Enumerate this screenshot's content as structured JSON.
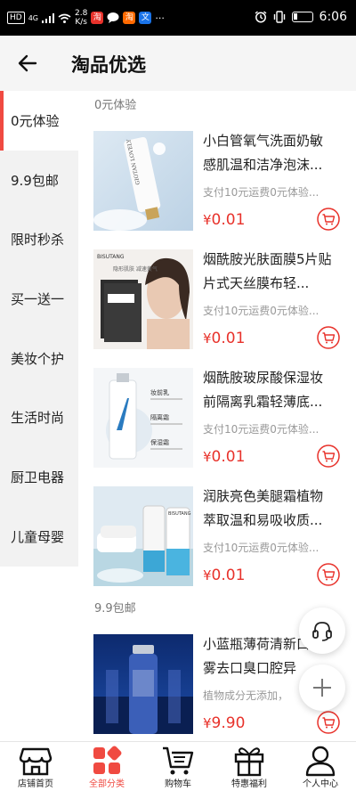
{
  "status_bar": {
    "network": "HD",
    "signal_label": "4G",
    "speed_value": "2.8",
    "speed_unit": "K/s",
    "app_icons": [
      "shopping-app-icon",
      "message-icon",
      "taobao-app-icon",
      "translate-app-icon"
    ],
    "more": "···",
    "time": "6:06"
  },
  "header": {
    "title": "淘品优选"
  },
  "sidebar": {
    "items": [
      {
        "label": "0元体验",
        "active": true
      },
      {
        "label": "9.9包邮"
      },
      {
        "label": "限时秒杀"
      },
      {
        "label": "买一送一"
      },
      {
        "label": "美妆个护"
      },
      {
        "label": "生活时尚"
      },
      {
        "label": "厨卫电器"
      },
      {
        "label": "儿童母婴"
      }
    ]
  },
  "sections": [
    {
      "label": "0元体验",
      "products": [
        {
          "title": "小白管氧气洗面奶敏感肌温和洁净泡沫...",
          "subtitle": "支付10元运费0元体验...",
          "currency": "¥",
          "price": "0.01"
        },
        {
          "title": "烟酰胺光肤面膜5片贴片式天丝膜布轻...",
          "subtitle": "支付10元运费0元体验...",
          "currency": "¥",
          "price": "0.01"
        },
        {
          "title": "烟酰胺玻尿酸保湿妆前隔离乳霜轻薄底...",
          "subtitle": "支付10元运费0元体验...",
          "currency": "¥",
          "price": "0.01"
        },
        {
          "title": "润肤亮色美腿霜植物萃取温和易吸收质...",
          "subtitle": "支付10元运费0元体验...",
          "currency": "¥",
          "price": "0.01"
        }
      ]
    },
    {
      "label": "9.9包邮",
      "products": [
        {
          "title": "小蓝瓶薄荷清新口喷雾去口臭口腔异",
          "subtitle": "植物成分无添加，",
          "currency": "¥",
          "price": "9.90"
        }
      ]
    }
  ],
  "product_images": {
    "p1_text": "GIOTAN LOVELY",
    "p2_brand": "BISUTANG",
    "p2_box_text": "隐形肌肤 减速黄气",
    "p3_tag1": "妆前乳",
    "p3_tag2": "隔离霜",
    "p3_tag3": "保湿霜",
    "p4_brand": "BISUTANG"
  },
  "tabbar": {
    "tabs": [
      {
        "label": "店铺首页",
        "icon": "store-icon"
      },
      {
        "label": "全部分类",
        "icon": "category-icon",
        "active": true
      },
      {
        "label": "购物车",
        "icon": "cart-icon"
      },
      {
        "label": "特惠福利",
        "icon": "gift-icon"
      },
      {
        "label": "个人中心",
        "icon": "user-icon"
      }
    ]
  },
  "colors": {
    "accent": "#f04a41",
    "price": "#e8322b",
    "sidebar_bg": "#f2f2f2",
    "header_bg": "#f5f5f5"
  }
}
